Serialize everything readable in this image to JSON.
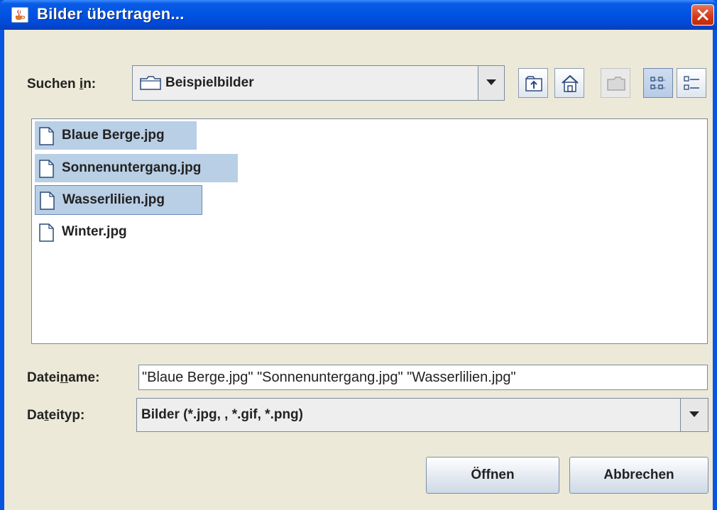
{
  "window": {
    "title": "Bilder übertragen..."
  },
  "lookin": {
    "label_pre": "Suchen ",
    "label_mnemonic": "i",
    "label_post": "n:",
    "value": "Beispielbilder"
  },
  "toolbar": {
    "buttons": [
      "up-one-level",
      "home",
      "new-folder",
      "list-view",
      "details-view"
    ]
  },
  "files": [
    {
      "name": "Blaue Berge.jpg",
      "selected": true
    },
    {
      "name": "Sonnenuntergang.jpg",
      "selected": true
    },
    {
      "name": "Wasserlilien.jpg",
      "selected": true,
      "focused": true
    },
    {
      "name": "Winter.jpg",
      "selected": false
    }
  ],
  "filename": {
    "label_pre": "Datei",
    "label_mnemonic": "n",
    "label_post": "ame:",
    "value": "\"Blaue Berge.jpg\" \"Sonnenuntergang.jpg\" \"Wasserlilien.jpg\""
  },
  "filetype": {
    "label_pre": "Da",
    "label_mnemonic": "t",
    "label_post": "eityp:",
    "value": "Bilder (*.jpg, , *.gif, *.png)"
  },
  "buttons": {
    "open": "Öffnen",
    "cancel": "Abbrechen"
  },
  "colors": {
    "titlebar": "#0054e3",
    "selection": "#b8cfe5",
    "dialog_bg": "#ece9d8"
  }
}
